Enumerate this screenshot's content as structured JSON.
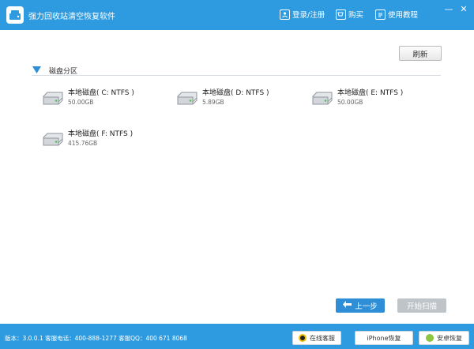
{
  "titlebar": {
    "app_title": "强力回收站清空恢复软件",
    "login_label": "登录/注册",
    "buy_label": "购买",
    "tutorial_label": "使用教程"
  },
  "toolbar": {
    "refresh_label": "刷新"
  },
  "section": {
    "title": "磁盘分区"
  },
  "disks": [
    {
      "name": "本地磁盘( C: NTFS )",
      "size": "50.00GB"
    },
    {
      "name": "本地磁盘( D: NTFS )",
      "size": "5.89GB"
    },
    {
      "name": "本地磁盘( E: NTFS )",
      "size": "50.00GB"
    },
    {
      "name": "本地磁盘( F: NTFS )",
      "size": "415.76GB"
    }
  ],
  "actions": {
    "prev_label": "上一步",
    "start_label": "开始扫描"
  },
  "statusbar": {
    "info": "版本：3.0.0.1  客服电话：400-888-1277    客服QQ：400 671 8068",
    "online_service_label": "在线客服",
    "iphone_recovery_label": "iPhone恢复",
    "android_recovery_label": "安卓恢复"
  },
  "colors": {
    "brand": "#2e9be0",
    "button_blue": "#2e8fd7",
    "button_disabled": "#bfc4c9"
  }
}
